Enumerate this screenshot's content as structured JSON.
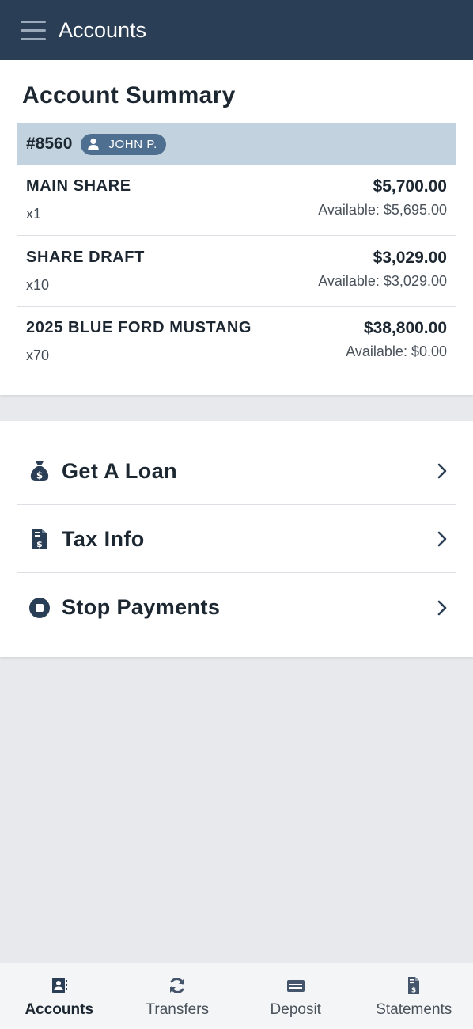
{
  "header": {
    "title": "Accounts"
  },
  "summary": {
    "title": "Account Summary",
    "account_number": "#8560",
    "owner": "JOHN P.",
    "accounts": [
      {
        "name": "MAIN SHARE",
        "suffix": "x1",
        "balance": "$5,700.00",
        "available": "Available: $5,695.00"
      },
      {
        "name": "SHARE DRAFT",
        "suffix": "x10",
        "balance": "$3,029.00",
        "available": "Available: $3,029.00"
      },
      {
        "name": "2025 BLUE FORD MUSTANG",
        "suffix": "x70",
        "balance": "$38,800.00",
        "available": "Available: $0.00"
      }
    ]
  },
  "actions": [
    {
      "label": "Get A Loan",
      "icon": "money-bag-icon"
    },
    {
      "label": "Tax Info",
      "icon": "tax-document-icon"
    },
    {
      "label": "Stop Payments",
      "icon": "stop-circle-icon"
    }
  ],
  "bottom_nav": [
    {
      "label": "Accounts",
      "icon": "account-book-icon",
      "active": true
    },
    {
      "label": "Transfers",
      "icon": "sync-arrows-icon",
      "active": false
    },
    {
      "label": "Deposit",
      "icon": "check-deposit-icon",
      "active": false
    },
    {
      "label": "Statements",
      "icon": "statement-document-icon",
      "active": false
    }
  ],
  "colors": {
    "header_bg": "#2a3e55",
    "account_header_bg": "#c2d3df",
    "owner_badge_bg": "#4f6f91",
    "page_bg": "#e8e9ec",
    "text_primary": "#1c2731"
  }
}
